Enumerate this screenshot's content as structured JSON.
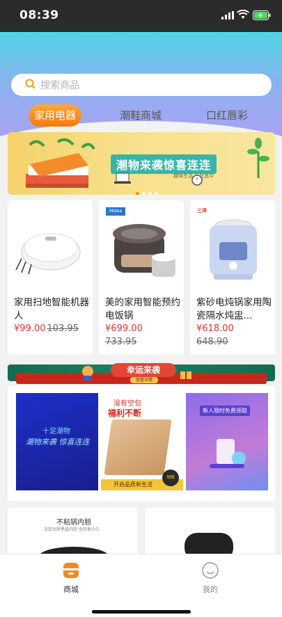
{
  "status_bar": {
    "time": "08:39"
  },
  "search": {
    "placeholder": "搜索商品"
  },
  "tabs": [
    {
      "label": "家用电器",
      "active": true
    },
    {
      "label": "潮鞋商城",
      "active": false
    },
    {
      "label": "口红唇彩",
      "active": false
    }
  ],
  "banner": {
    "title": "潮物来袭惊喜连连",
    "subtitle": "趣味生活 乐在其中",
    "page_dots": 4,
    "active_dot": 1
  },
  "products": [
    {
      "name": "家用扫地智能机器人",
      "price": "¥99.00",
      "original_price": "103.95"
    },
    {
      "name": "美的家用智能预约电饭锅",
      "price": "¥699.00",
      "original_price": "733.95",
      "brand_logo": "Midea"
    },
    {
      "name": "紫砂电炖锅家用陶瓷隔水炖盅...",
      "price": "¥618.00",
      "original_price": "648.90",
      "brand_logo": "三洋"
    }
  ],
  "lucky_banner": {
    "title": "幸运来袭",
    "sub": "查看详情"
  },
  "promos": [
    {
      "text1": "十足潮物",
      "text2": "潮物来袭 惊喜连连"
    },
    {
      "text1": "没有空包",
      "text2": "福利不断",
      "bottom": "开启品质新生活",
      "stamp": "领取"
    },
    {
      "text1": "新人限时免费领取"
    }
  ],
  "bottom_cards": [
    {
      "title": "不粘锅内胆",
      "sub": "加厚优质黑晶内胆 受热更均匀"
    },
    {
      "title": ""
    }
  ],
  "tab_bar": [
    {
      "label": "商城",
      "icon": "store-icon",
      "active": true
    },
    {
      "label": "我的",
      "icon": "smile-icon",
      "active": false
    }
  ],
  "colors": {
    "accent": "#f47a12",
    "price_red": "#e2342c",
    "header_top": "#51d3e6",
    "header_bottom": "#a9a3f3"
  }
}
